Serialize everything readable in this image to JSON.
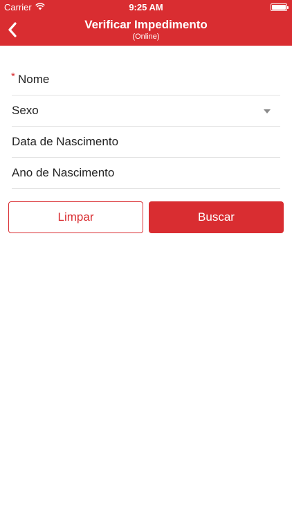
{
  "status_bar": {
    "carrier": "Carrier",
    "time": "9:25 AM"
  },
  "header": {
    "title": "Verificar Impedimento",
    "subtitle": "(Online)",
    "back_icon": "chevron-left-icon"
  },
  "form": {
    "required_mark": "*",
    "fields": [
      {
        "label": "Nome",
        "required": true
      },
      {
        "label": "Sexo",
        "type": "select"
      },
      {
        "label": "Data de Nascimento"
      },
      {
        "label": "Ano de Nascimento"
      }
    ]
  },
  "buttons": {
    "clear_label": "Limpar",
    "search_label": "Buscar"
  },
  "colors": {
    "accent": "#d92d31",
    "divider": "#e3e3e3",
    "text": "#222222",
    "arrow": "#8a8a8a"
  }
}
